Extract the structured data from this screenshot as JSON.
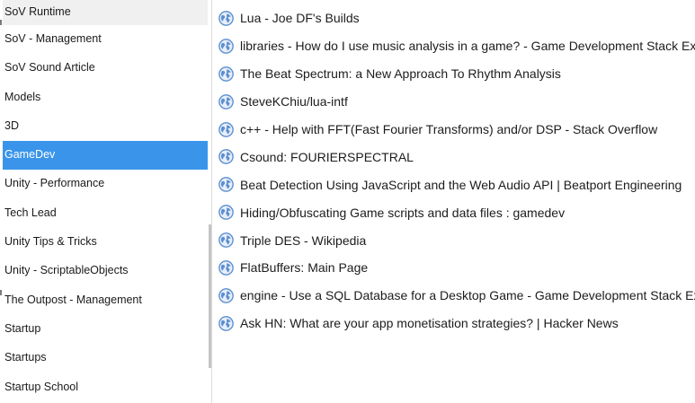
{
  "folders": [
    {
      "label": "SoV Runtime",
      "selected": false
    },
    {
      "label": "SoV - Management",
      "selected": false
    },
    {
      "label": "SoV Sound Article",
      "selected": false
    },
    {
      "label": "Models",
      "selected": false
    },
    {
      "label": "3D",
      "selected": false
    },
    {
      "label": "GameDev",
      "selected": true
    },
    {
      "label": "Unity - Performance",
      "selected": false
    },
    {
      "label": "Tech Lead",
      "selected": false
    },
    {
      "label": "Unity Tips & Tricks",
      "selected": false
    },
    {
      "label": "Unity - ScriptableObjects",
      "selected": false
    },
    {
      "label": "The Outpost - Management",
      "selected": false
    },
    {
      "label": "Startup",
      "selected": false
    },
    {
      "label": "Startups",
      "selected": false
    },
    {
      "label": "Startup School",
      "selected": false
    }
  ],
  "links": [
    {
      "title": "Lua - Joe DF's Builds",
      "icon": "globe-icon"
    },
    {
      "title": "libraries - How do I use music analysis in a game? - Game Development Stack Exchange",
      "icon": "globe-icon"
    },
    {
      "title": "The Beat Spectrum: a New Approach To Rhythm Analysis",
      "icon": "globe-icon"
    },
    {
      "title": "SteveKChiu/lua-intf",
      "icon": "globe-icon"
    },
    {
      "title": "c++ - Help with FFT(Fast Fourier Transforms) and/or DSP - Stack Overflow",
      "icon": "globe-icon"
    },
    {
      "title": "Csound: FOURIERSPECTRAL",
      "icon": "globe-icon"
    },
    {
      "title": "Beat Detection Using JavaScript and the Web Audio API | Beatport Engineering",
      "icon": "globe-icon"
    },
    {
      "title": "Hiding/Obfuscating Game scripts and data files : gamedev",
      "icon": "globe-icon"
    },
    {
      "title": "Triple DES - Wikipedia",
      "icon": "globe-icon"
    },
    {
      "title": "FlatBuffers: Main Page",
      "icon": "globe-icon"
    },
    {
      "title": "engine - Use a SQL Database for a Desktop Game - Game Development Stack Exchange",
      "icon": "globe-icon"
    },
    {
      "title": "Ask HN: What are your app monetisation strategies? | Hacker News",
      "icon": "globe-icon"
    }
  ],
  "colors": {
    "selection": "#3a95ea",
    "accent": "#3a8ee6",
    "globe": "#5b8fd1"
  }
}
